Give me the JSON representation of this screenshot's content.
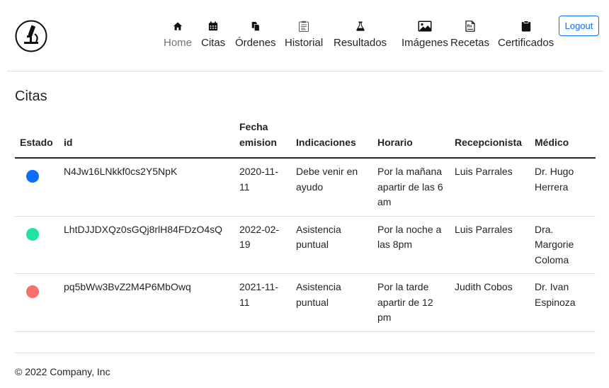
{
  "nav": {
    "items": [
      {
        "label": "Home",
        "icon": "home-icon"
      },
      {
        "label": "Citas",
        "icon": "calendar-icon"
      },
      {
        "label": "Órdenes",
        "icon": "documents-icon"
      },
      {
        "label": "Historial",
        "icon": "clipboard-list-icon"
      },
      {
        "label": "Resultados",
        "icon": "flask-icon"
      },
      {
        "label": "Imágenes",
        "icon": "image-icon"
      },
      {
        "label": "Recetas",
        "icon": "prescription-icon"
      },
      {
        "label": "Certificados",
        "icon": "clipboard-icon"
      }
    ],
    "logout_label": "Logout",
    "logo_icon": "microscope-icon"
  },
  "page": {
    "title": "Citas"
  },
  "table": {
    "headers": [
      "Estado",
      "id",
      "Fecha emision",
      "Indicaciones",
      "Horario",
      "Recepcionista",
      "Médico"
    ],
    "rows": [
      {
        "status_color": "#0d6efd",
        "id": "N4Jw16LNkkf0cs2Y5NpK",
        "fecha": "2020-11-11",
        "indicaciones": "Debe venir en ayudo",
        "horario": "Por la mañana apartir de las 6 am",
        "recepcionista": "Luis Parrales",
        "medico": "Dr. Hugo Herrera"
      },
      {
        "status_color": "#20e3a0",
        "id": "LhtDJJDXQz0sGQj8rlH84FDzO4sQ",
        "fecha": "2022-02-19",
        "indicaciones": "Asistencia puntual",
        "horario": "Por la noche a las 8pm",
        "recepcionista": "Luis Parrales",
        "medico": "Dra. Margorie Coloma"
      },
      {
        "status_color": "#f7706c",
        "id": "pq5bWw3BvZ2M4P6MbOwq",
        "fecha": "2021-11-11",
        "indicaciones": "Asistencia puntual",
        "horario": "Por la tarde apartir de 12 pm",
        "recepcionista": "Judith Cobos",
        "medico": "Dr. Ivan Espinoza"
      }
    ]
  },
  "footer": {
    "text": "© 2022 Company, Inc"
  },
  "colors": {
    "primary": "#0d6efd",
    "text": "#212529",
    "muted": "#6c757d",
    "border": "#dee2e6"
  }
}
